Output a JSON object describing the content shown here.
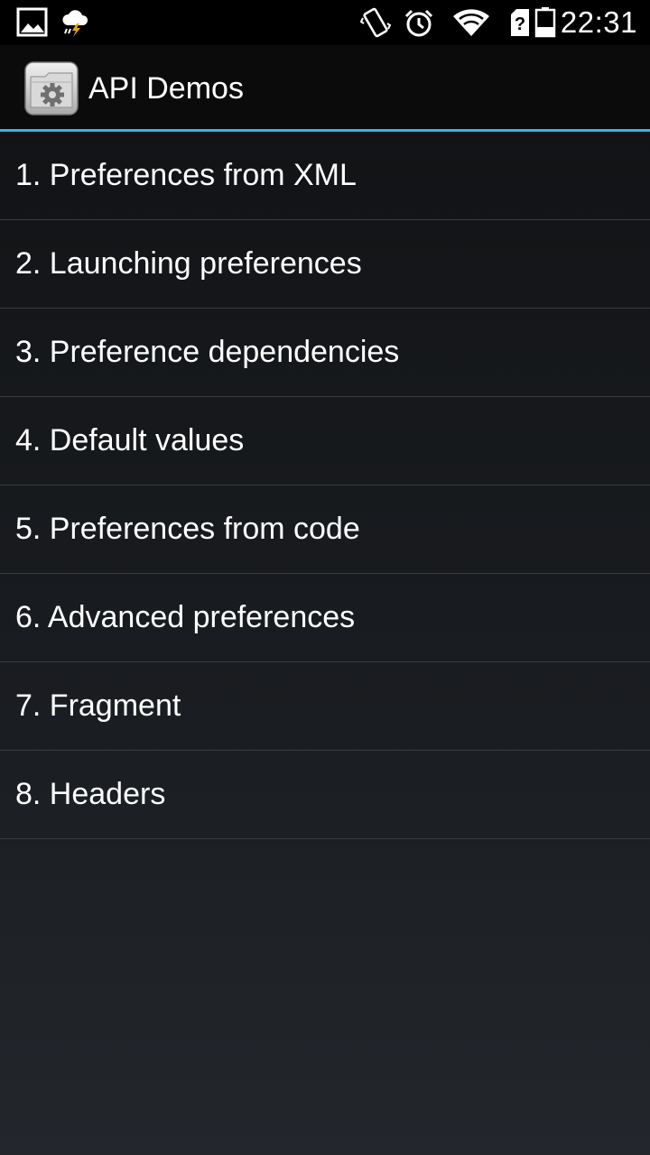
{
  "status_bar": {
    "time": "22:31",
    "left_icons": [
      "gallery-icon",
      "storm-weather-icon"
    ],
    "right_icons": [
      "vibrate-icon",
      "alarm-icon",
      "wifi-icon",
      "no-sim-icon",
      "battery-icon"
    ]
  },
  "action_bar": {
    "title": "API Demos",
    "icon": "settings-folder-icon",
    "accent_color": "#33b5e5"
  },
  "list": {
    "items": [
      {
        "label": "1. Preferences from XML"
      },
      {
        "label": "2. Launching preferences"
      },
      {
        "label": "3. Preference dependencies"
      },
      {
        "label": "4. Default values"
      },
      {
        "label": "5. Preferences from code"
      },
      {
        "label": "6. Advanced preferences"
      },
      {
        "label": "7. Fragment"
      },
      {
        "label": "8. Headers"
      }
    ]
  }
}
